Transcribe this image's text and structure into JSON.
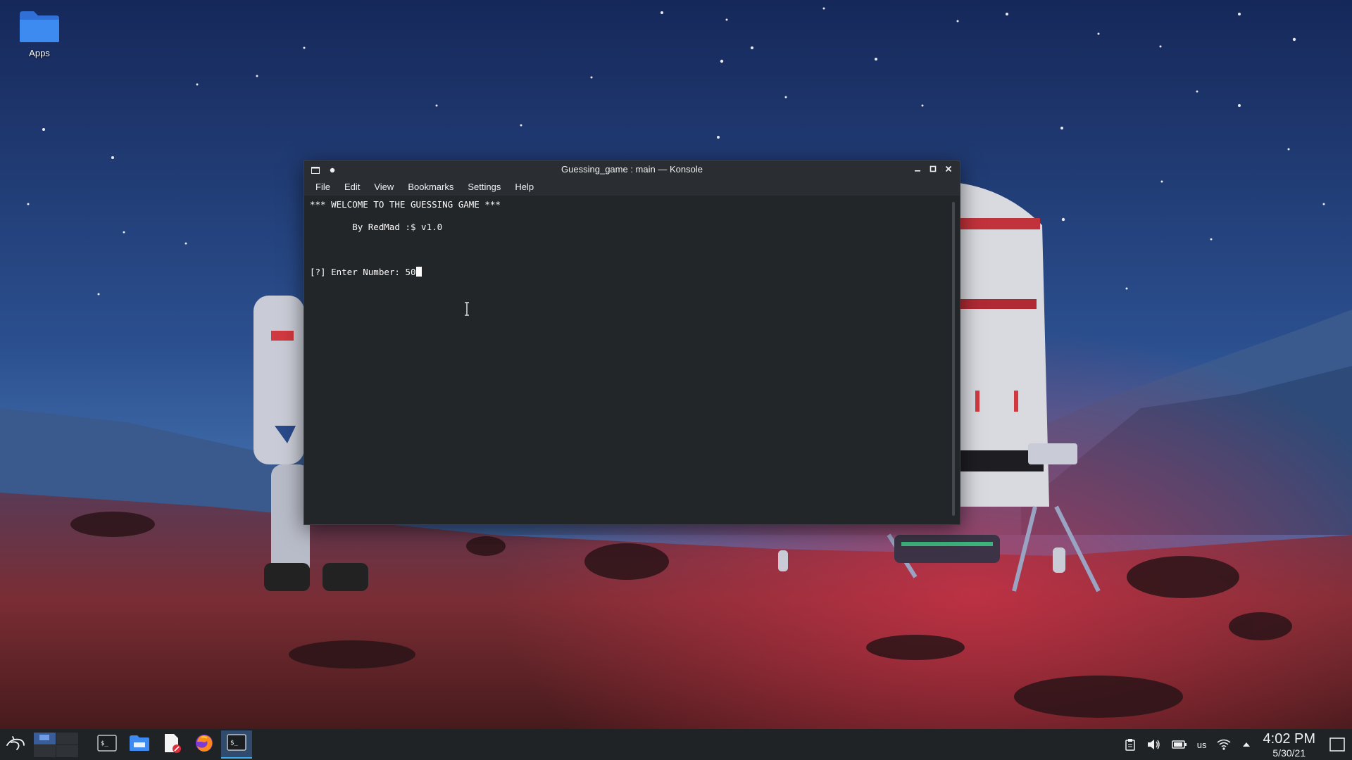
{
  "desktop": {
    "icons": [
      {
        "label": "Apps",
        "icon": "folder-icon"
      }
    ]
  },
  "window": {
    "title": "Guessing_game : main — Konsole",
    "menu": [
      "File",
      "Edit",
      "View",
      "Bookmarks",
      "Settings",
      "Help"
    ],
    "terminal": {
      "lines": [
        "*** WELCOME TO THE GUESSING GAME ***",
        "",
        "        By RedMad :$ v1.0",
        "",
        "",
        "",
        "[?] Enter Number: 50"
      ]
    }
  },
  "taskbar": {
    "launcher_icon": "kali-dragon-icon",
    "apps": [
      {
        "name": "terminal-icon",
        "active": false
      },
      {
        "name": "file-manager-icon",
        "active": false
      },
      {
        "name": "text-editor-icon",
        "active": false
      },
      {
        "name": "firefox-icon",
        "active": false
      },
      {
        "name": "konsole-icon",
        "active": true
      }
    ],
    "tray": {
      "keyboard_layout": "us",
      "time": "4:02 PM",
      "date": "5/30/21"
    }
  },
  "colors": {
    "accent": "#3daee9",
    "window_bg": "#232629",
    "panel_bg": "#202326"
  }
}
